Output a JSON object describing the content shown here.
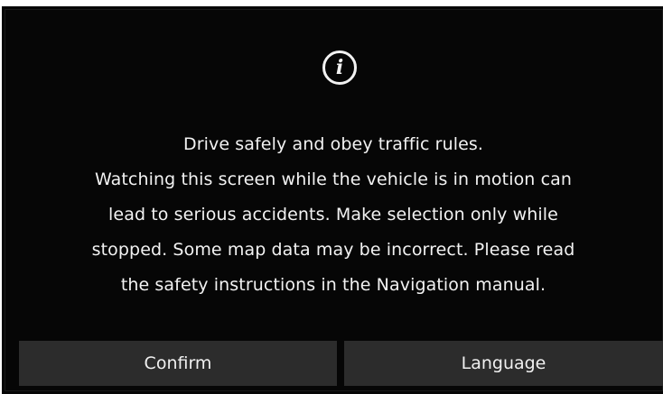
{
  "dialog": {
    "icon": "info-icon",
    "icon_glyph": "i",
    "message_lines": [
      "Drive safely and obey traffic rules.",
      "Watching this screen while the vehicle is in motion can",
      "lead to serious accidents. Make selection only while",
      "stopped. Some map data may be incorrect. Please read",
      "the safety instructions in the Navigation manual."
    ]
  },
  "buttons": {
    "confirm_label": "Confirm",
    "language_label": "Language"
  },
  "colors": {
    "background": "#060606",
    "text": "#f2f2f2",
    "button": "#2c2c2c"
  }
}
